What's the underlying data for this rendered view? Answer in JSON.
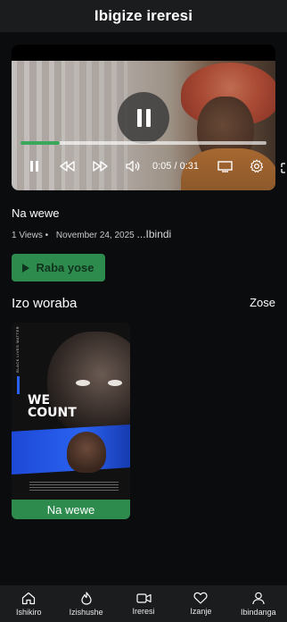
{
  "header": {
    "title": "Ibigize ireresi"
  },
  "player": {
    "time": "0:05 / 0:31",
    "progress": 0.16,
    "accent_color": "#3aa65e",
    "icons": [
      "pause-icon",
      "rewind-icon",
      "fast-forward-icon",
      "volume-icon",
      "cast-icon",
      "settings-icon",
      "fullscreen-icon"
    ]
  },
  "video": {
    "title": "Na wewe",
    "views": "1 Views •",
    "date": "November 24, 2025",
    "more": "...Ibindi"
  },
  "actions": {
    "watch_label": "Raba yose"
  },
  "related": {
    "title": "Izo woraba",
    "see_all": "Zose",
    "items": [
      {
        "label": "Na wewe",
        "poster_headline_1": "WE",
        "poster_headline_2": "COUNT",
        "poster_side_text": "BLACK LIVES MATTER"
      }
    ]
  },
  "nav": {
    "items": [
      {
        "label": "Ishikiro",
        "icon": "home-icon"
      },
      {
        "label": "Izishushe",
        "icon": "flame-icon"
      },
      {
        "label": "Ireresi",
        "icon": "video-icon"
      },
      {
        "label": "Izanje",
        "icon": "heart-icon"
      },
      {
        "label": "Ibindanga",
        "icon": "person-icon"
      }
    ]
  },
  "colors": {
    "background": "#0b0c0e",
    "bar": "#1b1c1e",
    "green": "#2e8b4e"
  }
}
